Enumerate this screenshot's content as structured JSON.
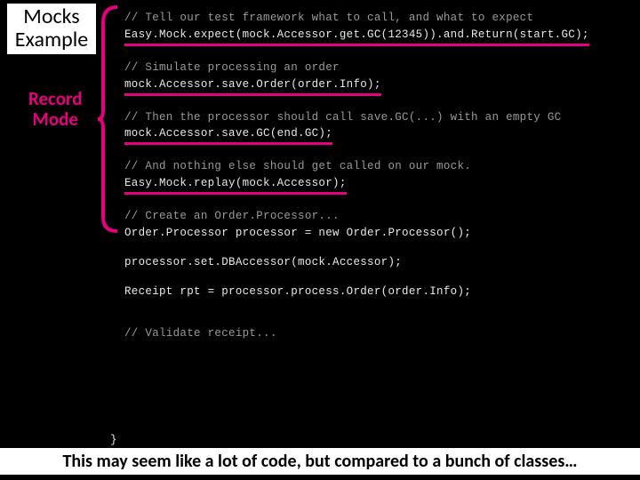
{
  "title_l1": "Mocks",
  "title_l2": "Example",
  "record_l1": "Record",
  "record_l2": "Mode",
  "code": {
    "c1": "// Tell our test framework what to call, and what to expect",
    "l1": "Easy.Mock.expect(mock.Accessor.get.GC(12345)).and.Return(start.GC);",
    "c2": "// Simulate processing an order",
    "l2": "mock.Accessor.save.Order(order.Info);",
    "c3": "// Then the processor should call save.GC(...) with an empty GC",
    "l3": "mock.Accessor.save.GC(end.GC);",
    "c4": "// And nothing else should get called on our mock.",
    "l4": "Easy.Mock.replay(mock.Accessor);",
    "c5": "// Create an Order.Processor...",
    "l5": "Order.Processor processor = new Order.Processor();",
    "l6": "processor.set.DBAccessor(mock.Accessor);",
    "l7": "Receipt rpt = processor.process.Order(order.Info);",
    "c6": "// Validate receipt...",
    "brace": "}"
  },
  "footer": "This may seem like a lot of code, but compared to a bunch of classes…"
}
